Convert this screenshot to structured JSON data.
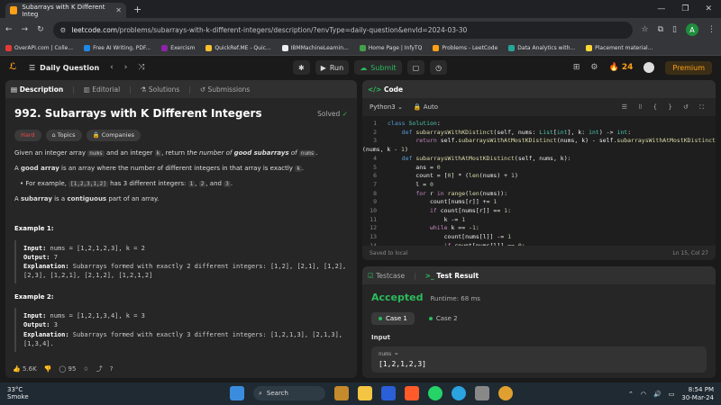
{
  "browser": {
    "tab_title": "Subarrays with K Different Integ",
    "url_host": "leetcode.com",
    "url_path": "/problems/subarrays-with-k-different-integers/description/?envType=daily-question&envId=2024-03-30",
    "profile_initial": "A",
    "bookmarks": [
      "OverAPI.com | Colle...",
      "Free AI Writing, PDF...",
      "Exercism",
      "QuickRef.ME - Quic...",
      "IBMMachineLearnin...",
      "Home Page | InfyTQ",
      "Problems - LeetCode",
      "Data Analytics with...",
      "Placement material..."
    ]
  },
  "nav": {
    "daily": "Daily Question",
    "run": "Run",
    "submit": "Submit",
    "streak": "24",
    "premium": "Premium"
  },
  "left_tabs": [
    "Description",
    "Editorial",
    "Solutions",
    "Submissions"
  ],
  "problem": {
    "title": "992. Subarrays with K Different Integers",
    "solved": "Solved",
    "difficulty": "Hard",
    "topics": "Topics",
    "companies": "Companies",
    "p1a": "Given an integer array ",
    "p1_nums": "nums",
    "p1b": " and an integer ",
    "p1_k": "k",
    "p1c": ", return ",
    "p1_em": "the number of ",
    "p1_good": "good subarrays",
    "p1d": " of ",
    "p1_nums2": "nums",
    "p1e": ".",
    "p2a": "A ",
    "p2_good": "good array",
    "p2b": " is an array where the number of different integers in that array is exactly ",
    "p2_k": "k",
    "p2c": ".",
    "li_a": "For example, ",
    "li_code": "[1,2,3,1,2]",
    "li_b": " has ",
    "li_three": "3",
    "li_c": " different integers: ",
    "li_1": "1",
    "li_comma1": ", ",
    "li_2": "2",
    "li_and": ", and ",
    "li_3": "3",
    "li_d": ".",
    "p3a": "A ",
    "p3_sub": "subarray",
    "p3b": " is a ",
    "p3_contig": "contiguous",
    "p3c": " part of an array.",
    "ex1_title": "Example 1:",
    "ex1_in_lbl": "Input:",
    "ex1_in": " nums = [1,2,1,2,3], k = 2",
    "ex1_out_lbl": "Output:",
    "ex1_out": " 7",
    "ex1_exp_lbl": "Explanation:",
    "ex1_exp": " Subarrays formed with exactly 2 different integers: [1,2], [2,1], [1,2], [2,3], [1,2,1], [2,1,2], [1,2,1,2]",
    "ex2_title": "Example 2:",
    "ex2_in_lbl": "Input:",
    "ex2_in": " nums = [1,2,1,3,4], k = 3",
    "ex2_out_lbl": "Output:",
    "ex2_out": " 3",
    "ex2_exp_lbl": "Explanation:",
    "ex2_exp": " Subarrays formed with exactly 3 different integers: [1,2,1,3], [2,1,3], [1,3,4].",
    "likes": "5.6K",
    "comments": "95"
  },
  "code": {
    "header": "Code",
    "lang": "Python3",
    "auto": "Auto",
    "saved": "Saved to local",
    "cursor": "Ln 15, Col 27",
    "line_numbers": [
      "1",
      "2",
      "3",
      "",
      "4",
      "5",
      "6",
      "7",
      "8",
      "9",
      "10",
      "11",
      "12",
      "13",
      "14"
    ]
  },
  "results": {
    "testcase_tab": "Testcase",
    "result_tab": "Test Result",
    "status": "Accepted",
    "runtime": "Runtime: 68 ms",
    "case1": "Case 1",
    "case2": "Case 2",
    "input_label": "Input",
    "input_key": "nums =",
    "input_value": "[1,2,1,2,3]"
  },
  "taskbar": {
    "temp": "33°C",
    "weather": "Smoke",
    "search": "Search",
    "time": "8:54 PM",
    "date": "30-Mar-24"
  },
  "colors": {
    "accent": "#ffa116",
    "accepted": "#2cbb5d",
    "hard": "#ef4743"
  }
}
